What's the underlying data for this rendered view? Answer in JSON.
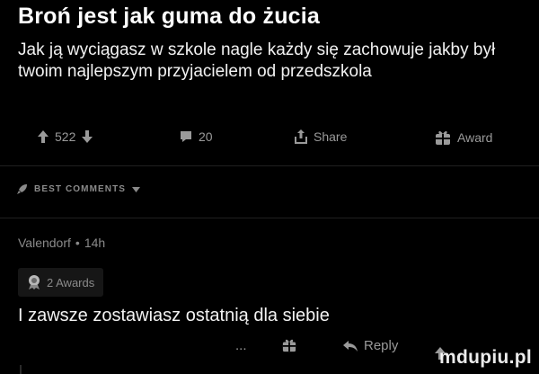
{
  "post": {
    "title": "Broń jest jak guma do żucia",
    "body": "Jak ją wyciągasz w szkole nagle każdy się zachowuje jakby był twoim najlepszym przyjacielem od przedszkola"
  },
  "post_actions": {
    "score": "522",
    "comments": "20",
    "share": "Share",
    "award": "Award"
  },
  "comments_sort": {
    "label": "BEST COMMENTS"
  },
  "comment": {
    "author": "Valendorf",
    "separator": "•",
    "age": "14h",
    "awards": "2 Awards",
    "text": "I zawsze zostawiasz ostatnią dla siebie",
    "more": "...",
    "reply": "Reply"
  },
  "watermark": "mdupiu.pl",
  "colors": {
    "background": "#000000",
    "text": "#ffffff",
    "muted": "#9a9a9a",
    "divider": "#202020"
  }
}
